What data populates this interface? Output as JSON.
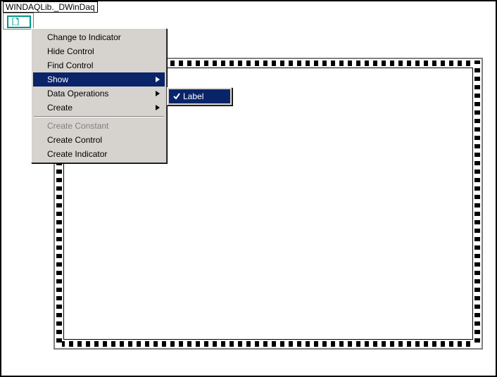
{
  "object_label": "WINDAQLib._DWinDaq",
  "context_menu": {
    "items": [
      {
        "label": "Change to Indicator",
        "submenu": false,
        "disabled": false,
        "highlight": false
      },
      {
        "label": "Hide Control",
        "submenu": false,
        "disabled": false,
        "highlight": false
      },
      {
        "label": "Find Control",
        "submenu": false,
        "disabled": false,
        "highlight": false
      },
      {
        "label": "Show",
        "submenu": true,
        "disabled": false,
        "highlight": true
      },
      {
        "label": "Data Operations",
        "submenu": true,
        "disabled": false,
        "highlight": false
      },
      {
        "label": "Create",
        "submenu": true,
        "disabled": false,
        "highlight": false
      }
    ],
    "items2": [
      {
        "label": "Create Constant",
        "submenu": false,
        "disabled": true,
        "highlight": false
      },
      {
        "label": "Create Control",
        "submenu": false,
        "disabled": false,
        "highlight": false
      },
      {
        "label": "Create Indicator",
        "submenu": false,
        "disabled": false,
        "highlight": false
      }
    ]
  },
  "submenu": {
    "items": [
      {
        "label": "Label",
        "checked": true,
        "highlight": true
      }
    ]
  },
  "icons": {
    "doc": "document-icon",
    "arrow": "submenu-arrow-icon",
    "check": "check-icon"
  },
  "colors": {
    "menu_bg": "#d6d3ce",
    "highlight": "#0a246a",
    "teal": "#009688"
  }
}
